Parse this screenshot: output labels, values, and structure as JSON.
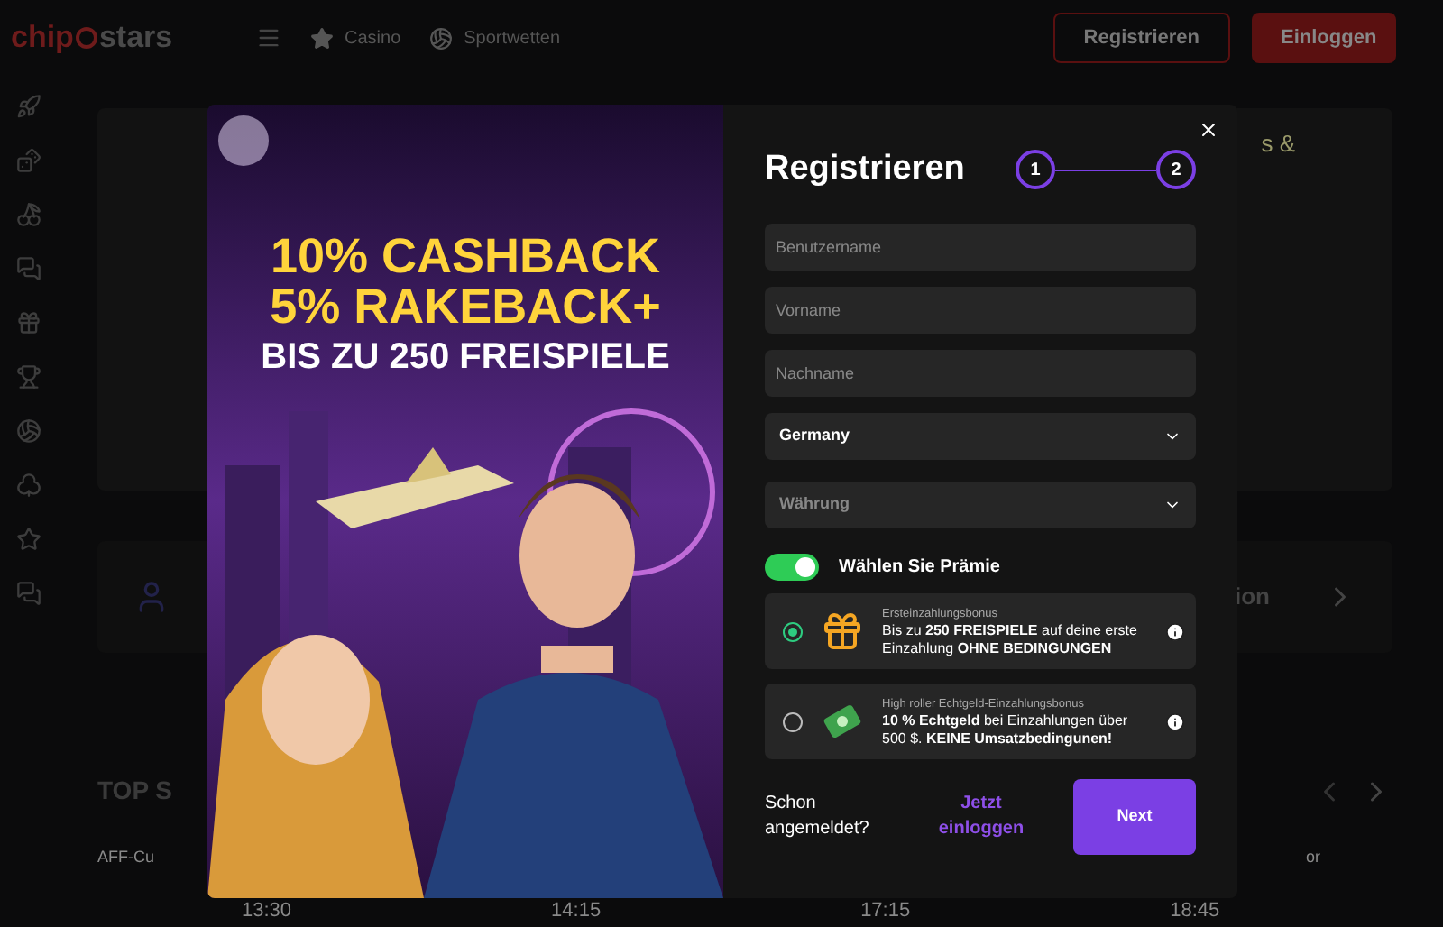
{
  "header": {
    "logo_left": "chip",
    "logo_right": "stars",
    "nav": [
      {
        "label": "Casino",
        "kind": "star"
      },
      {
        "label": "Sportwetten",
        "kind": "ball"
      }
    ],
    "buttons": [
      {
        "label": "Registrieren",
        "kind": "outline"
      },
      {
        "label": "Einloggen",
        "kind": "filled"
      }
    ]
  },
  "background": {
    "banner_text": "s &",
    "section_text": "ion",
    "top_title": "TOP S",
    "tab_left": "AFF-Cu",
    "tab_right": "or",
    "times": [
      "13:30",
      "14:15",
      "17:15",
      "18:45"
    ]
  },
  "modal": {
    "promo": [
      "10% CASHBACK",
      "5% RAKEBACK+",
      "BIS ZU 250 FREISPIELE"
    ],
    "title": "Registrieren",
    "steps": [
      "1",
      "2"
    ],
    "fields": [
      {
        "kind": "input",
        "placeholder": "Benutzername"
      },
      {
        "kind": "input",
        "placeholder": "Vorname"
      },
      {
        "kind": "input",
        "placeholder": "Nachname"
      },
      {
        "kind": "select",
        "value": "Germany"
      },
      {
        "kind": "select",
        "placeholder": "Währung"
      }
    ],
    "bonus_toggle": {
      "label": "Wählen Sie Prämie",
      "on": true
    },
    "bonuses": [
      {
        "kind": "gift",
        "title": "Ersteinzahlungsbonus",
        "text": "Bis zu **250 FREISPIELE** auf deine erste Einzahlung **OHNE BEDINGUNGEN**",
        "selected": true
      },
      {
        "kind": "cash",
        "title": "High roller Echtgeld-Einzahlungsbonus",
        "text": "**10 % Echtgeld** bei Einzahlungen über 500 $. **KEINE Umsatzbedingunen!**",
        "selected": false
      }
    ],
    "login_prompt": "Schon angemeldet?",
    "login_link": "Jetzt einloggen",
    "next": "Next"
  }
}
